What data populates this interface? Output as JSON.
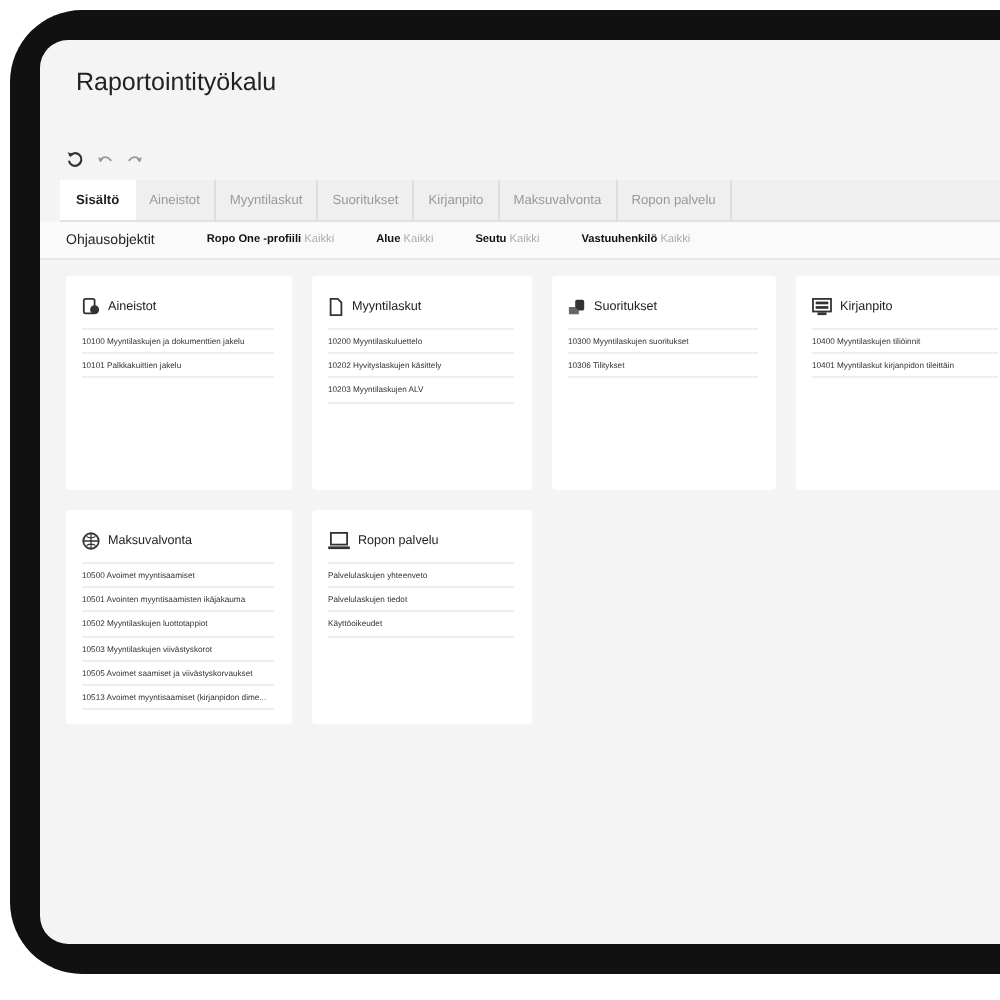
{
  "window": {
    "title": "Raportointityökalu"
  },
  "tabs": [
    {
      "label": "Sisältö",
      "selected": true
    },
    {
      "label": "Aineistot",
      "selected": false
    },
    {
      "label": "Myyntilaskut",
      "selected": false
    },
    {
      "label": "Suoritukset",
      "selected": false
    },
    {
      "label": "Kirjanpito",
      "selected": false
    },
    {
      "label": "Maksuvalvonta",
      "selected": false
    },
    {
      "label": "Ropon palvelu",
      "selected": false
    }
  ],
  "filters": {
    "label": "Ohjausobjektit",
    "items": [
      {
        "name": "Ropo One -profiili",
        "value": "Kaikki"
      },
      {
        "name": "Alue",
        "value": "Kaikki"
      },
      {
        "name": "Seutu",
        "value": "Kaikki"
      },
      {
        "name": "Vastuuhenkilö",
        "value": "Kaikki"
      }
    ]
  },
  "cards": [
    {
      "title": "Aineistot",
      "reports": [
        "10100 Myyntilaskujen ja dokumenttien jakelu",
        "10101 Palkkakuittien jakelu"
      ]
    },
    {
      "title": "Myyntilaskut",
      "reports": [
        "10200 Myyntilaskuluettelo",
        "10202 Hyvityslaskujen käsittely",
        "10203 Myyntilaskujen ALV"
      ]
    },
    {
      "title": "Suoritukset",
      "reports": [
        "10300 Myyntilaskujen suoritukset",
        "10306 Tilitykset"
      ]
    },
    {
      "title": "Kirjanpito",
      "reports": [
        "10400 Myyntilaskujen tiliöinnit",
        "10401 Myyntilaskut kirjanpidon tileittäin"
      ]
    },
    {
      "title": "Maksuvalvonta",
      "reports": [
        "10500 Avoimet myyntisaamiset",
        "10501 Avointen myyntisaamisten ikäjakauma",
        "10502 Myyntilaskujen luottotappiot",
        "10503 Myyntilaskujen viivästyskorot",
        "10505 Avoimet saamiset ja viivästyskorvaukset",
        "10513 Avoimet myyntisaamiset (kirjanpidon dime..."
      ]
    },
    {
      "title": "Ropon palvelu",
      "reports": [
        "Palvelulaskujen yhteenveto",
        "Palvelulaskujen tiedot",
        "Käyttöoikeudet"
      ]
    }
  ]
}
